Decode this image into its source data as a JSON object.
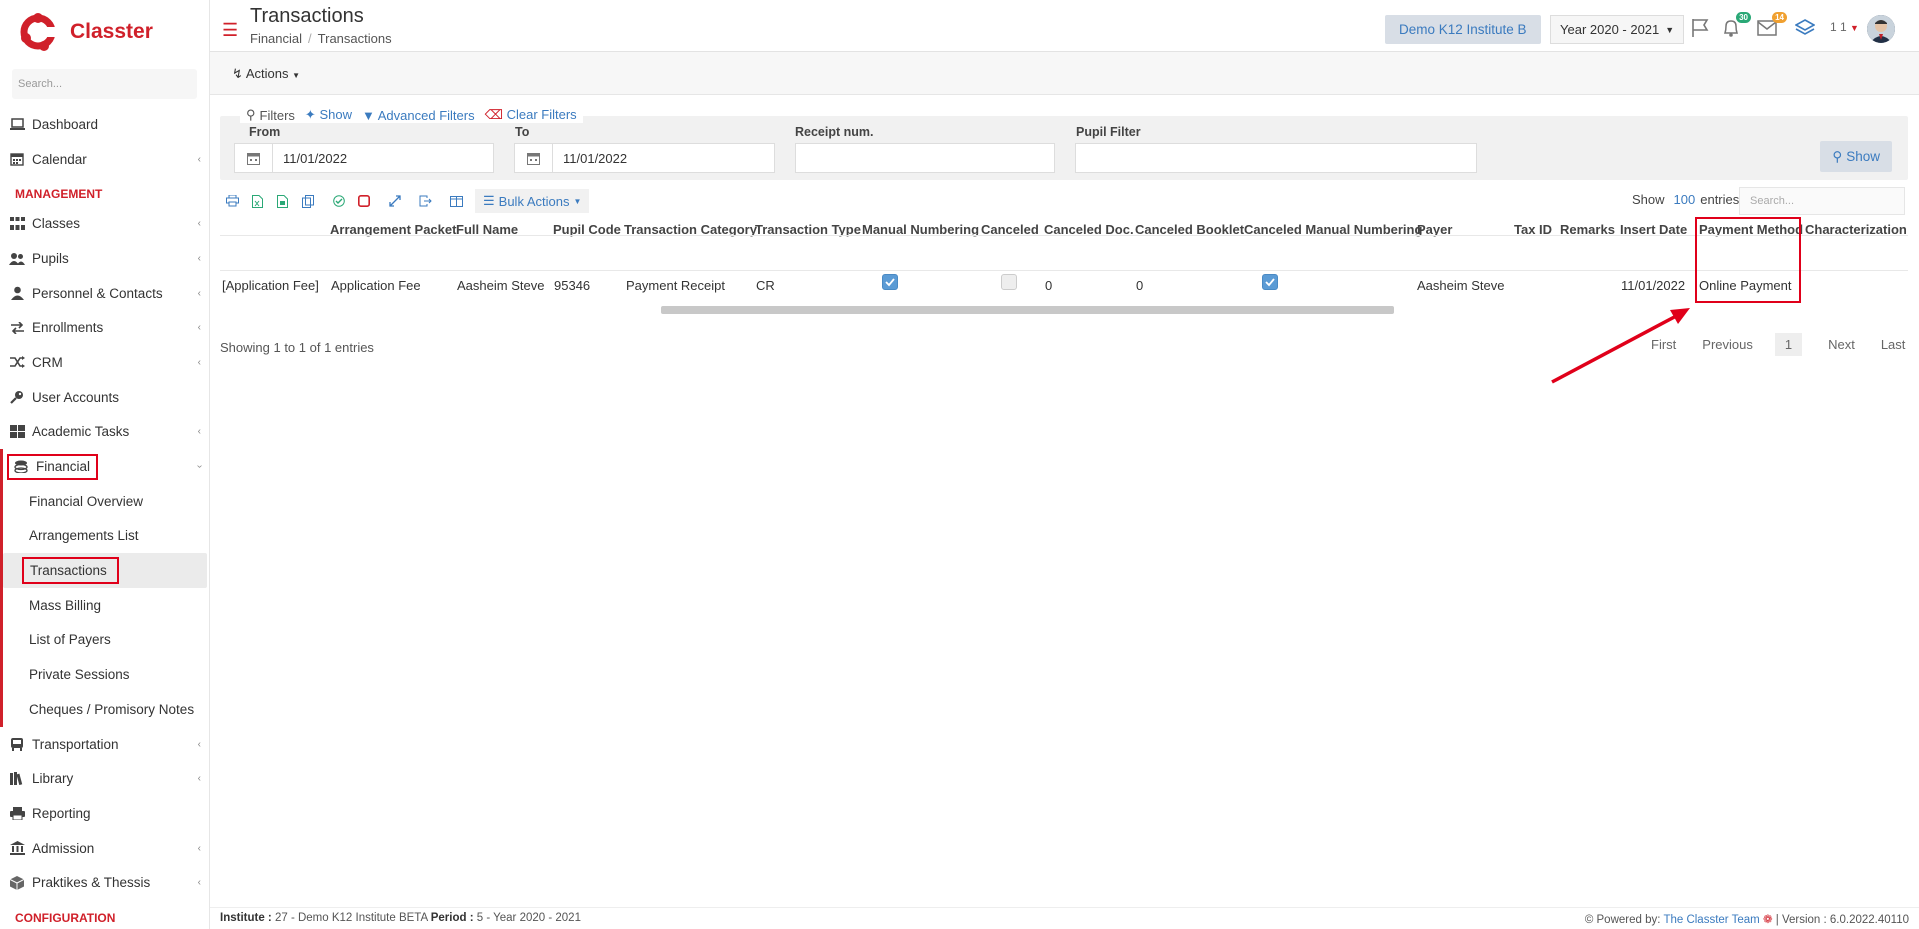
{
  "app": {
    "name": "Classter",
    "search_placeholder": "Search..."
  },
  "sidebar": {
    "items_top": [
      {
        "label": "Dashboard",
        "icon": "laptop-icon",
        "chevron": false
      },
      {
        "label": "Calendar",
        "icon": "calendar-icon",
        "chevron": true
      }
    ],
    "management_label": "MANAGEMENT",
    "items_mgmt": [
      {
        "label": "Classes",
        "icon": "classes-icon",
        "chevron": true
      },
      {
        "label": "Pupils",
        "icon": "users-icon",
        "chevron": true
      },
      {
        "label": "Personnel & Contacts",
        "icon": "person-icon",
        "chevron": true
      },
      {
        "label": "Enrollments",
        "icon": "exchange-icon",
        "chevron": true
      },
      {
        "label": "CRM",
        "icon": "shuffle-icon",
        "chevron": true
      },
      {
        "label": "User Accounts",
        "icon": "key-icon",
        "chevron": false
      },
      {
        "label": "Academic Tasks",
        "icon": "grid-icon",
        "chevron": true
      }
    ],
    "financial": {
      "label": "Financial",
      "icon": "coins-icon",
      "sub_items": [
        "Financial Overview",
        "Arrangements List",
        "Transactions",
        "Mass Billing",
        "List of Payers",
        "Private Sessions",
        "Cheques / Promisory Notes"
      ],
      "active": "Transactions"
    },
    "items_bottom": [
      {
        "label": "Transportation",
        "icon": "bus-icon",
        "chevron": true
      },
      {
        "label": "Library",
        "icon": "books-icon",
        "chevron": true
      },
      {
        "label": "Reporting",
        "icon": "printer-icon",
        "chevron": false
      },
      {
        "label": "Admission",
        "icon": "bank-icon",
        "chevron": true
      },
      {
        "label": "Praktikes & Thessis",
        "icon": "cube-icon",
        "chevron": true
      }
    ],
    "configuration_label": "CONFIGURATION"
  },
  "header": {
    "title": "Transactions",
    "breadcrumb": [
      "Financial",
      "Transactions"
    ],
    "institute": "Demo K12 Institute B",
    "year": "Year 2020 - 2021",
    "notifications_count": "30",
    "messages_count": "14",
    "user_num": "1 1"
  },
  "actions": {
    "label": "Actions"
  },
  "filters": {
    "legend": "Filters",
    "show_link": "Show",
    "advanced_link": "Advanced Filters",
    "clear_link": "Clear Filters",
    "from_label": "From",
    "from_value": "11/01/2022",
    "to_label": "To",
    "to_value": "11/01/2022",
    "receipt_label": "Receipt num.",
    "receipt_value": "",
    "pupil_label": "Pupil Filter",
    "pupil_value": "",
    "show_button": "Show"
  },
  "toolbar": {
    "bulk_actions": "Bulk Actions",
    "show_label": "Show",
    "entries_count": "100",
    "entries_label": "entries",
    "search_placeholder": "Search..."
  },
  "table": {
    "headers": [
      "Arrangement Packet",
      "Full Name",
      "Pupil Code",
      "Transaction Category",
      "Transaction Type",
      "Manual Numbering",
      "Canceled",
      "Canceled Doc.",
      "Canceled Booklet",
      "Canceled Manual Numbering",
      "Payer",
      "Tax ID",
      "Remarks",
      "Insert Date",
      "Payment Method",
      "Characterization"
    ],
    "row": {
      "lead": "[Application Fee]",
      "arrangement_packet": "Application Fee",
      "full_name": "Aasheim Steve",
      "pupil_code": "95346",
      "transaction_category": "Payment Receipt",
      "transaction_type": "CR",
      "manual_numbering": true,
      "canceled": false,
      "canceled_doc": "0",
      "canceled_booklet": "0",
      "canceled_manual_numbering": true,
      "payer": "Aasheim Steve",
      "tax_id": "",
      "remarks": "",
      "insert_date": "11/01/2022",
      "payment_method": "Online Payment",
      "characterization": ""
    },
    "showing": "Showing 1 to 1 of 1 entries",
    "pager": {
      "first": "First",
      "previous": "Previous",
      "current": "1",
      "next": "Next",
      "last": "Last"
    }
  },
  "footer": {
    "institute_label": "Institute :",
    "institute_value": "27 - Demo K12 Institute BETA",
    "period_label": "Period :",
    "period_value": "5 - Year 2020 - 2021",
    "powered_by": "Powered by:",
    "team": "The Classter Team",
    "version": "| Version : 6.0.2022.40110"
  },
  "colors": {
    "brand": "#d0202a",
    "link": "#3b7bbf",
    "highlight": "#e0001a"
  }
}
